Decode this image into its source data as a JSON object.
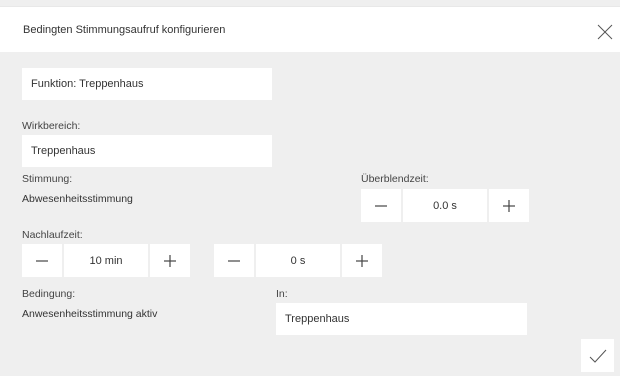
{
  "dialog": {
    "title": "Bedingten Stimmungsaufruf konfigurieren"
  },
  "function_field": {
    "value": "Funktion: Treppenhaus"
  },
  "scope": {
    "label": "Wirkbereich:",
    "value": "Treppenhaus"
  },
  "mood": {
    "label": "Stimmung:",
    "value": "Abwesenheitsstimmung"
  },
  "fade": {
    "label": "Überblendzeit:",
    "value": "0.0 s"
  },
  "followup": {
    "label": "Nachlaufzeit:",
    "minutes": "10 min",
    "seconds": "0 s"
  },
  "condition": {
    "label": "Bedingung:",
    "value": "Anwesenheitsstimmung aktiv"
  },
  "in_area": {
    "label": "In:",
    "value": "Treppenhaus"
  },
  "icons": {
    "close": "close-icon",
    "confirm": "checkmark-icon",
    "minus": "minus-icon",
    "plus": "plus-icon"
  }
}
